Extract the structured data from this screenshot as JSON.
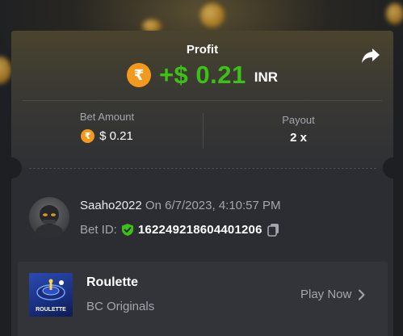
{
  "header": {
    "profit_label": "Profit",
    "profit_amount": "+$ 0.21",
    "profit_currency": "INR",
    "currency_symbol": "₹"
  },
  "stats": {
    "bet_amount_label": "Bet Amount",
    "bet_amount_value": "$ 0.21",
    "payout_label": "Payout",
    "payout_value": "2 x"
  },
  "user": {
    "username": "Saaho2022",
    "date": "On 6/7/2023, 4:10:57 PM",
    "bet_id_label": "Bet ID:",
    "bet_id": "162249218604401206"
  },
  "game": {
    "name": "Roulette",
    "provider": "BC Originals",
    "thumb_label": "ROULETTE",
    "play_label": "Play Now"
  },
  "colors": {
    "profit_green": "#3bc117",
    "coin_orange": "#f39a1e",
    "verified_green": "#3bc117"
  },
  "icons": [
    "share-icon",
    "rupee-coin-icon",
    "verified-shield-icon",
    "copy-icon",
    "chevron-right-icon"
  ]
}
